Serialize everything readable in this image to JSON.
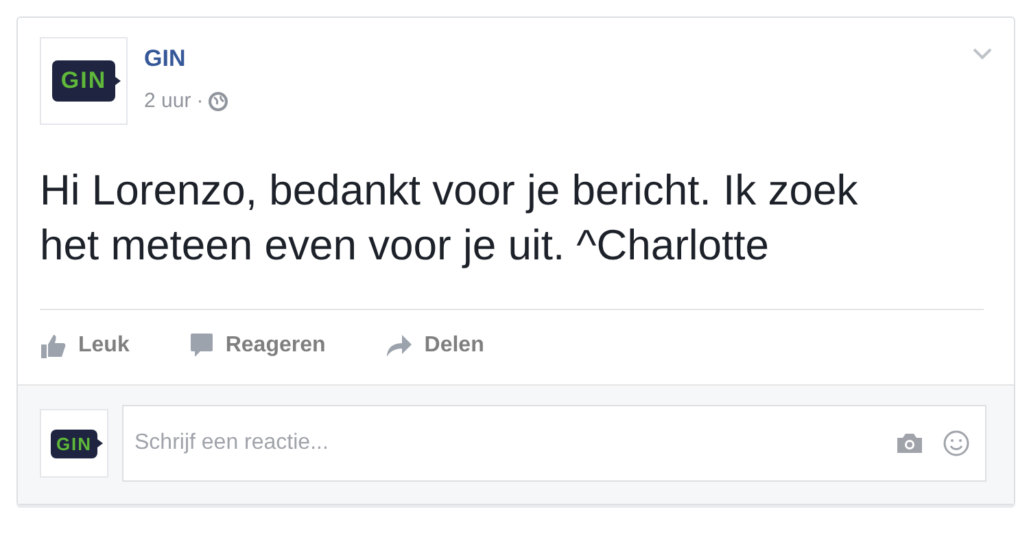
{
  "post": {
    "author": "GIN",
    "avatar_text": "GIN",
    "time": "2 uur",
    "separator": "·",
    "message": "Hi Lorenzo, bedankt voor je bericht. Ik zoek het meteen even voor je uit. ^Charlotte"
  },
  "actions": [
    {
      "kind": "like",
      "label": "Leuk"
    },
    {
      "kind": "comment",
      "label": "Reageren"
    },
    {
      "kind": "share",
      "label": "Delen"
    }
  ],
  "comment_box": {
    "avatar_text": "GIN",
    "placeholder": "Schrijf een reactie..."
  }
}
